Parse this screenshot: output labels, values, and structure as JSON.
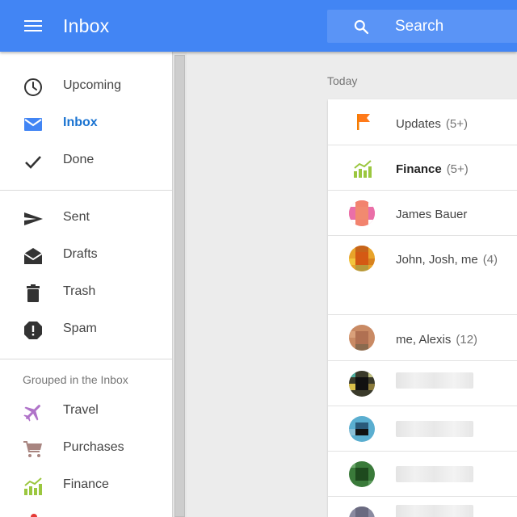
{
  "header": {
    "title": "Inbox",
    "search_label": "Search",
    "color": "#4285f4"
  },
  "sidebar": {
    "items": [
      {
        "label": "Upcoming",
        "icon": "clock-icon"
      },
      {
        "label": "Inbox",
        "icon": "envelope-icon",
        "active": true
      },
      {
        "label": "Done",
        "icon": "checkmark-icon"
      },
      {
        "label": "Sent",
        "icon": "send-icon"
      },
      {
        "label": "Drafts",
        "icon": "drafts-icon"
      },
      {
        "label": "Trash",
        "icon": "trash-icon"
      },
      {
        "label": "Spam",
        "icon": "spam-icon"
      }
    ],
    "group_heading": "Grouped in the Inbox",
    "groups": [
      {
        "label": "Travel",
        "icon": "airplane-icon",
        "color": "#b073c9"
      },
      {
        "label": "Purchases",
        "icon": "cart-icon",
        "color": "#a88580"
      },
      {
        "label": "Finance",
        "icon": "finance-chart-icon",
        "color": "#9bc73f"
      }
    ]
  },
  "main": {
    "section_label": "Today",
    "rows": [
      {
        "label": "Updates",
        "count": "(5+)",
        "icon": "flag-icon"
      },
      {
        "label": "Finance",
        "count": "(5+)",
        "icon": "finance-chart-icon",
        "bold": true
      },
      {
        "label": "James Bauer",
        "count": "",
        "icon": "avatar"
      },
      {
        "label": "John, Josh, me",
        "count": "(4)",
        "icon": "avatar"
      },
      {
        "label": "me, Alexis",
        "count": "(12)",
        "icon": "avatar"
      }
    ]
  },
  "accent_color": "#1a73d1"
}
